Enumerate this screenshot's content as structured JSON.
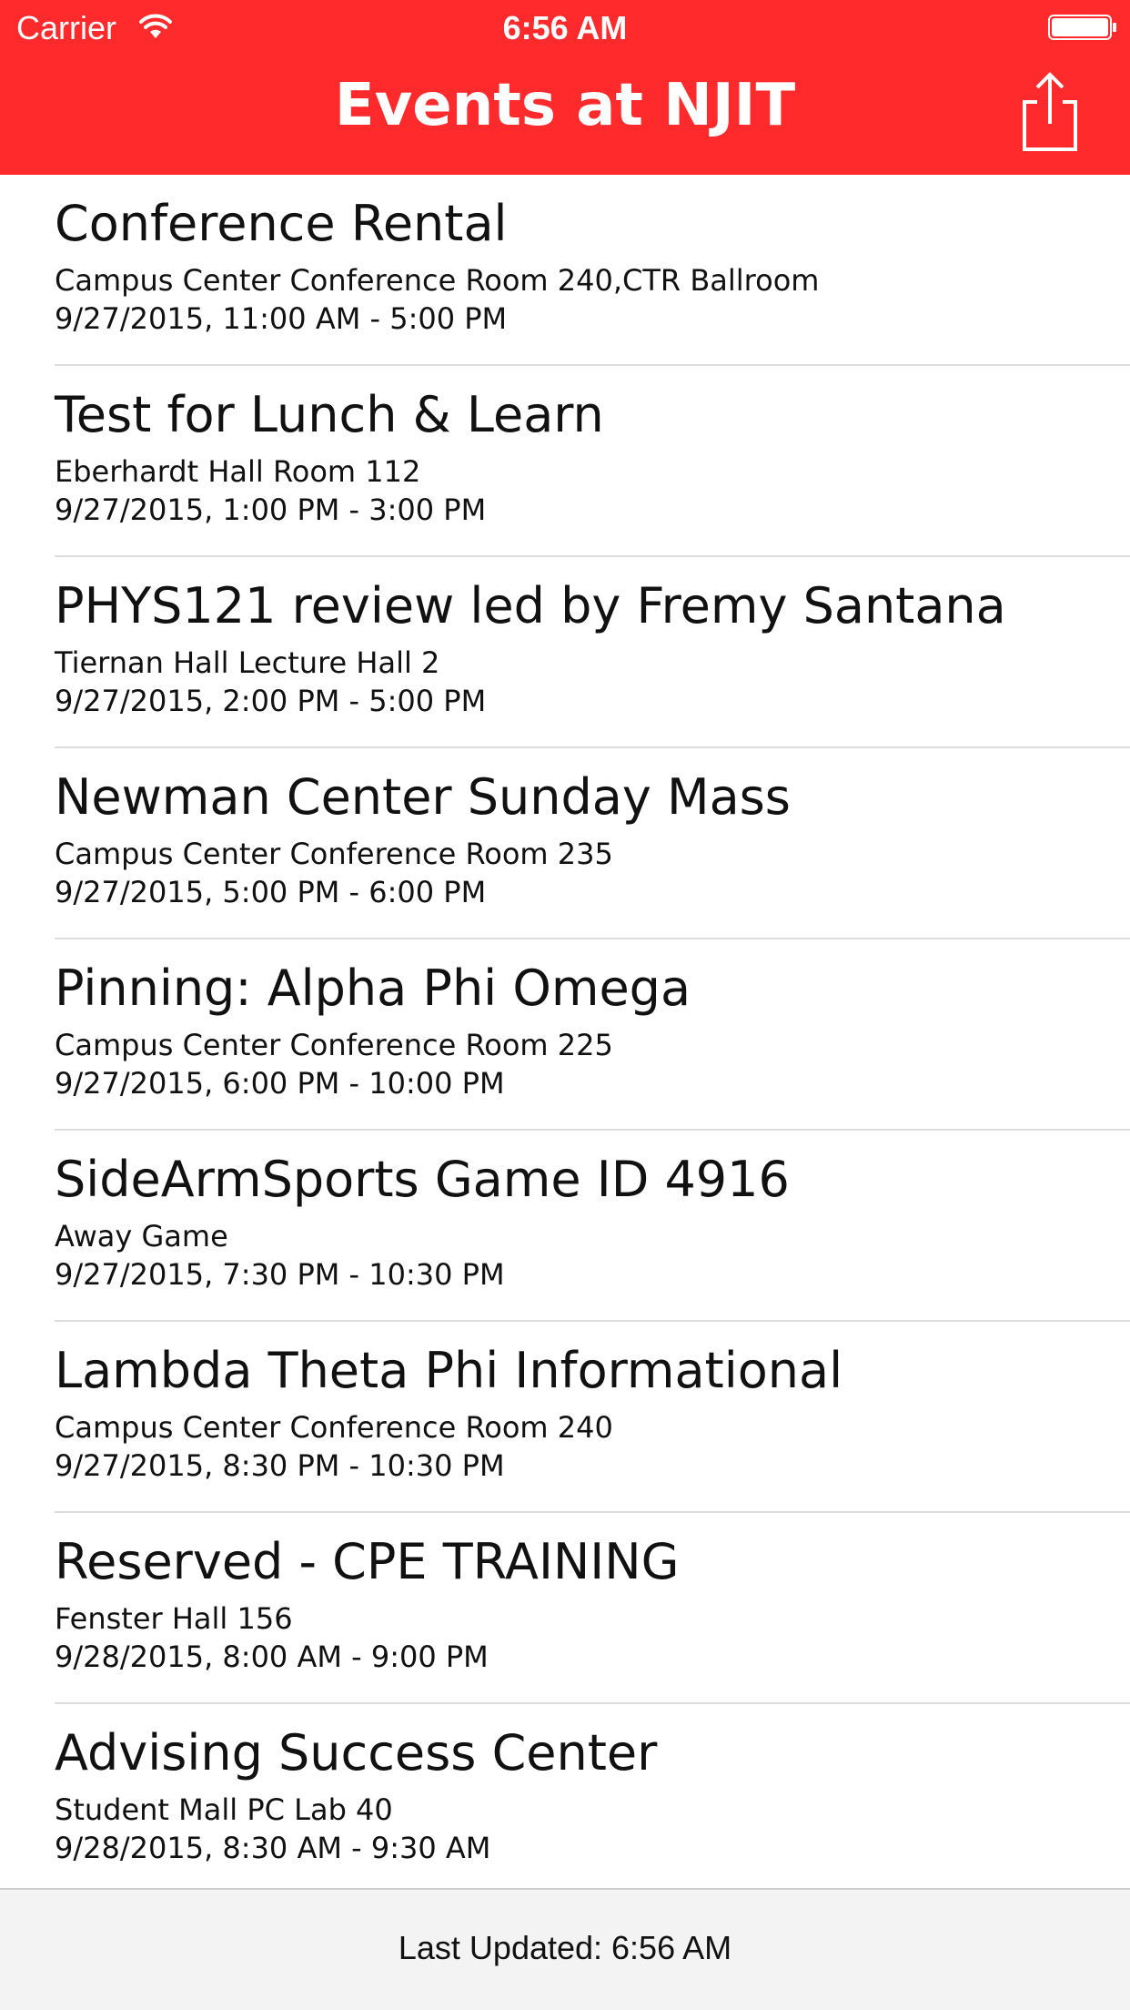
{
  "status_bar": {
    "carrier": "Carrier",
    "time": "6:56 AM",
    "wifi_icon": "wifi-icon",
    "battery_icon": "battery-icon"
  },
  "nav_bar": {
    "title": "Events at NJIT",
    "share_icon": "share-icon",
    "background_color": "#fe2a2b"
  },
  "events": [
    {
      "title": "Conference Rental",
      "location": "Campus Center Conference Room 240,CTR Ballroom",
      "time": "9/27/2015, 11:00 AM - 5:00 PM"
    },
    {
      "title": "Test for Lunch & Learn",
      "location": "Eberhardt Hall Room 112",
      "time": "9/27/2015, 1:00 PM - 3:00 PM"
    },
    {
      "title": "PHYS121 review led by Fremy Santana",
      "location": "Tiernan Hall Lecture Hall 2",
      "time": "9/27/2015, 2:00 PM - 5:00 PM"
    },
    {
      "title": "Newman Center Sunday Mass",
      "location": "Campus Center Conference Room 235",
      "time": "9/27/2015, 5:00 PM - 6:00 PM"
    },
    {
      "title": "Pinning: Alpha Phi Omega",
      "location": "Campus Center Conference Room 225",
      "time": "9/27/2015, 6:00 PM - 10:00 PM"
    },
    {
      "title": "SideArmSports Game ID 4916",
      "location": "Away Game",
      "time": "9/27/2015, 7:30 PM - 10:30 PM"
    },
    {
      "title": "Lambda Theta Phi Informational",
      "location": "Campus Center Conference Room 240",
      "time": "9/27/2015, 8:30 PM - 10:30 PM"
    },
    {
      "title": "Reserved - CPE TRAINING",
      "location": "Fenster Hall 156",
      "time": "9/28/2015, 8:00 AM - 9:00 PM"
    },
    {
      "title": "Advising Success Center",
      "location": "Student Mall PC Lab 40",
      "time": "9/28/2015, 8:30 AM - 9:30 AM"
    }
  ],
  "footer": {
    "last_updated": "Last Updated: 6:56 AM"
  }
}
